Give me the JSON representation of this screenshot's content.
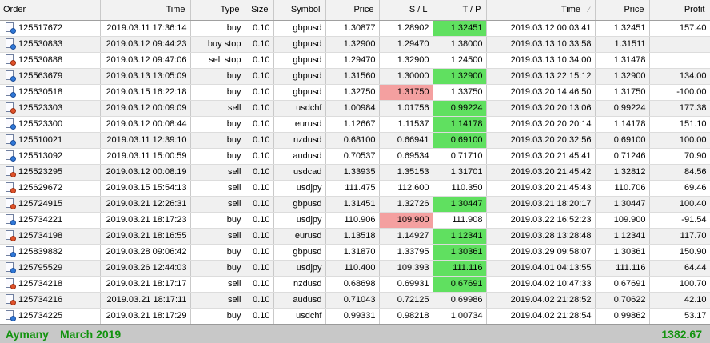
{
  "columns": {
    "order": "Order",
    "time": "Time",
    "type": "Type",
    "size": "Size",
    "symbol": "Symbol",
    "price": "Price",
    "sl": "S / L",
    "tp": "T / P",
    "close_time": "Time",
    "close_price": "Price",
    "profit": "Profit"
  },
  "sort_indicator": "sort-descending-icon",
  "colors": {
    "highlight_green": "#60e060",
    "highlight_red": "#f4a0a0",
    "footer_text": "#13930f"
  },
  "rows": [
    {
      "order": "125517672",
      "icon": "buy",
      "time": "2019.03.11 17:36:14",
      "type": "buy",
      "size": "0.10",
      "symbol": "gbpusd",
      "price": "1.30877",
      "sl": "1.28902",
      "sl_hl": "",
      "tp": "1.32451",
      "tp_hl": "green",
      "close_time": "2019.03.12 00:03:41",
      "close_price": "1.32451",
      "profit": "157.40"
    },
    {
      "order": "125530833",
      "icon": "buy",
      "time": "2019.03.12 09:44:23",
      "type": "buy stop",
      "size": "0.10",
      "symbol": "gbpusd",
      "price": "1.32900",
      "sl": "1.29470",
      "sl_hl": "",
      "tp": "1.38000",
      "tp_hl": "",
      "close_time": "2019.03.13 10:33:58",
      "close_price": "1.31511",
      "profit": ""
    },
    {
      "order": "125530888",
      "icon": "sell",
      "time": "2019.03.12 09:47:06",
      "type": "sell stop",
      "size": "0.10",
      "symbol": "gbpusd",
      "price": "1.29470",
      "sl": "1.32900",
      "sl_hl": "",
      "tp": "1.24500",
      "tp_hl": "",
      "close_time": "2019.03.13 10:34:00",
      "close_price": "1.31478",
      "profit": ""
    },
    {
      "order": "125563679",
      "icon": "buy",
      "time": "2019.03.13 13:05:09",
      "type": "buy",
      "size": "0.10",
      "symbol": "gbpusd",
      "price": "1.31560",
      "sl": "1.30000",
      "sl_hl": "",
      "tp": "1.32900",
      "tp_hl": "green",
      "close_time": "2019.03.13 22:15:12",
      "close_price": "1.32900",
      "profit": "134.00"
    },
    {
      "order": "125630518",
      "icon": "buy",
      "time": "2019.03.15 16:22:18",
      "type": "buy",
      "size": "0.10",
      "symbol": "gbpusd",
      "price": "1.32750",
      "sl": "1.31750",
      "sl_hl": "red",
      "tp": "1.33750",
      "tp_hl": "",
      "close_time": "2019.03.20 14:46:50",
      "close_price": "1.31750",
      "profit": "-100.00"
    },
    {
      "order": "125523303",
      "icon": "sell",
      "time": "2019.03.12 00:09:09",
      "type": "sell",
      "size": "0.10",
      "symbol": "usdchf",
      "price": "1.00984",
      "sl": "1.01756",
      "sl_hl": "",
      "tp": "0.99224",
      "tp_hl": "green",
      "close_time": "2019.03.20 20:13:06",
      "close_price": "0.99224",
      "profit": "177.38"
    },
    {
      "order": "125523300",
      "icon": "buy",
      "time": "2019.03.12 00:08:44",
      "type": "buy",
      "size": "0.10",
      "symbol": "eurusd",
      "price": "1.12667",
      "sl": "1.11537",
      "sl_hl": "",
      "tp": "1.14178",
      "tp_hl": "green",
      "close_time": "2019.03.20 20:20:14",
      "close_price": "1.14178",
      "profit": "151.10"
    },
    {
      "order": "125510021",
      "icon": "buy",
      "time": "2019.03.11 12:39:10",
      "type": "buy",
      "size": "0.10",
      "symbol": "nzdusd",
      "price": "0.68100",
      "sl": "0.66941",
      "sl_hl": "",
      "tp": "0.69100",
      "tp_hl": "green",
      "close_time": "2019.03.20 20:32:56",
      "close_price": "0.69100",
      "profit": "100.00"
    },
    {
      "order": "125513092",
      "icon": "buy",
      "time": "2019.03.11 15:00:59",
      "type": "buy",
      "size": "0.10",
      "symbol": "audusd",
      "price": "0.70537",
      "sl": "0.69534",
      "sl_hl": "",
      "tp": "0.71710",
      "tp_hl": "",
      "close_time": "2019.03.20 21:45:41",
      "close_price": "0.71246",
      "profit": "70.90"
    },
    {
      "order": "125523295",
      "icon": "sell",
      "time": "2019.03.12 00:08:19",
      "type": "sell",
      "size": "0.10",
      "symbol": "usdcad",
      "price": "1.33935",
      "sl": "1.35153",
      "sl_hl": "",
      "tp": "1.31701",
      "tp_hl": "",
      "close_time": "2019.03.20 21:45:42",
      "close_price": "1.32812",
      "profit": "84.56"
    },
    {
      "order": "125629672",
      "icon": "sell",
      "time": "2019.03.15 15:54:13",
      "type": "sell",
      "size": "0.10",
      "symbol": "usdjpy",
      "price": "111.475",
      "sl": "112.600",
      "sl_hl": "",
      "tp": "110.350",
      "tp_hl": "",
      "close_time": "2019.03.20 21:45:43",
      "close_price": "110.706",
      "profit": "69.46"
    },
    {
      "order": "125724915",
      "icon": "sell",
      "time": "2019.03.21 12:26:31",
      "type": "sell",
      "size": "0.10",
      "symbol": "gbpusd",
      "price": "1.31451",
      "sl": "1.32726",
      "sl_hl": "",
      "tp": "1.30447",
      "tp_hl": "green",
      "close_time": "2019.03.21 18:20:17",
      "close_price": "1.30447",
      "profit": "100.40"
    },
    {
      "order": "125734221",
      "icon": "buy",
      "time": "2019.03.21 18:17:23",
      "type": "buy",
      "size": "0.10",
      "symbol": "usdjpy",
      "price": "110.906",
      "sl": "109.900",
      "sl_hl": "red",
      "tp": "111.908",
      "tp_hl": "",
      "close_time": "2019.03.22 16:52:23",
      "close_price": "109.900",
      "profit": "-91.54"
    },
    {
      "order": "125734198",
      "icon": "sell",
      "time": "2019.03.21 18:16:55",
      "type": "sell",
      "size": "0.10",
      "symbol": "eurusd",
      "price": "1.13518",
      "sl": "1.14927",
      "sl_hl": "",
      "tp": "1.12341",
      "tp_hl": "green",
      "close_time": "2019.03.28 13:28:48",
      "close_price": "1.12341",
      "profit": "117.70"
    },
    {
      "order": "125839882",
      "icon": "buy",
      "time": "2019.03.28 09:06:42",
      "type": "buy",
      "size": "0.10",
      "symbol": "gbpusd",
      "price": "1.31870",
      "sl": "1.33795",
      "sl_hl": "",
      "tp": "1.30361",
      "tp_hl": "green",
      "close_time": "2019.03.29 09:58:07",
      "close_price": "1.30361",
      "profit": "150.90"
    },
    {
      "order": "125795529",
      "icon": "buy",
      "time": "2019.03.26 12:44:03",
      "type": "buy",
      "size": "0.10",
      "symbol": "usdjpy",
      "price": "110.400",
      "sl": "109.393",
      "sl_hl": "",
      "tp": "111.116",
      "tp_hl": "green",
      "close_time": "2019.04.01 04:13:55",
      "close_price": "111.116",
      "profit": "64.44"
    },
    {
      "order": "125734218",
      "icon": "sell",
      "time": "2019.03.21 18:17:17",
      "type": "sell",
      "size": "0.10",
      "symbol": "nzdusd",
      "price": "0.68698",
      "sl": "0.69931",
      "sl_hl": "",
      "tp": "0.67691",
      "tp_hl": "green",
      "close_time": "2019.04.02 10:47:33",
      "close_price": "0.67691",
      "profit": "100.70"
    },
    {
      "order": "125734216",
      "icon": "sell",
      "time": "2019.03.21 18:17:11",
      "type": "sell",
      "size": "0.10",
      "symbol": "audusd",
      "price": "0.71043",
      "sl": "0.72125",
      "sl_hl": "",
      "tp": "0.69986",
      "tp_hl": "",
      "close_time": "2019.04.02 21:28:52",
      "close_price": "0.70622",
      "profit": "42.10"
    },
    {
      "order": "125734225",
      "icon": "buy",
      "time": "2019.03.21 18:17:29",
      "type": "buy",
      "size": "0.10",
      "symbol": "usdchf",
      "price": "0.99331",
      "sl": "0.98218",
      "sl_hl": "",
      "tp": "1.00734",
      "tp_hl": "",
      "close_time": "2019.04.02 21:28:54",
      "close_price": "0.99862",
      "profit": "53.17"
    }
  ],
  "footer": {
    "broker": "Aymany",
    "period": "March 2019",
    "total": "1382.67"
  }
}
